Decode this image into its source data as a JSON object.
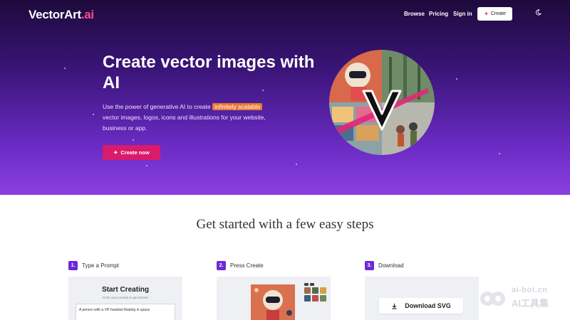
{
  "header": {
    "logo_main": "VectorArt",
    "logo_suffix": ".ai",
    "nav": [
      "Browse",
      "Pricing",
      "Sign in"
    ],
    "create_label": "Create",
    "icons": {
      "theme_toggle": "moon-icon",
      "create": "sparkle-icon"
    }
  },
  "hero": {
    "title": "Create vector images with AI",
    "desc_before": "Use the power of generative AI to create ",
    "desc_highlight": "infinitely scalable",
    "desc_after": " vector images, logos, icons and illustrations for your website, business or app.",
    "cta_label": "Create now",
    "colors": {
      "bg_top": "#1e0a3c",
      "bg_bottom": "#8b3fe0",
      "accent": "#d81b6a",
      "highlight": "#e8792f"
    }
  },
  "steps_section": {
    "title": "Get started with a few easy steps",
    "steps": [
      {
        "num": "1.",
        "label": "Type a Prompt"
      },
      {
        "num": "2.",
        "label": "Press Create"
      },
      {
        "num": "3.",
        "label": "Download"
      }
    ],
    "prompt_panel": {
      "title": "Start Creating",
      "subtitle": "Enter your prompt to get started",
      "input_value": "A person with a VR headset floating in space"
    },
    "download_label": "Download SVG"
  },
  "watermark": {
    "line1": "ai-bot.cn",
    "line2": "AI工具集"
  }
}
